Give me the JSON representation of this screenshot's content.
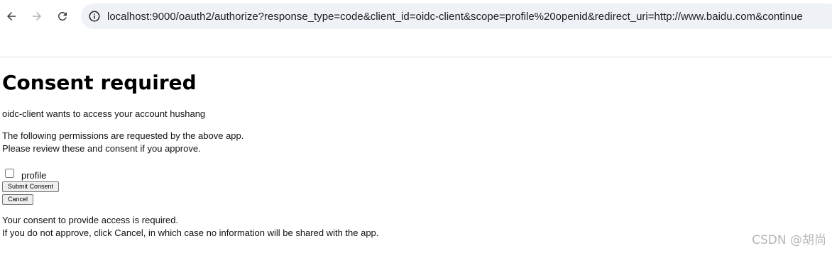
{
  "browser": {
    "url": "localhost:9000/oauth2/authorize?response_type=code&client_id=oidc-client&scope=profile%20openid&redirect_uri=http://www.baidu.com&continue"
  },
  "page": {
    "title": "Consent required",
    "client_line": "oidc-client wants to access your account hushang",
    "permissions_intro_1": "The following permissions are requested by the above app.",
    "permissions_intro_2": "Please review these and consent if you approve.",
    "scope": {
      "label": "profile",
      "checked": false
    },
    "submit_label": "Submit Consent",
    "cancel_label": "Cancel",
    "notice_1": "Your consent to provide access is required.",
    "notice_2": "If you do not approve, click Cancel, in which case no information will be shared with the app."
  },
  "watermark": "CSDN @胡尚",
  "icons": {
    "back": "arrow-left-icon",
    "forward": "arrow-right-icon",
    "reload": "reload-icon",
    "site_info": "info-icon"
  },
  "colors": {
    "omnibox_bg": "#eef1f6",
    "forward_disabled": "#b0b0b0",
    "button_bg": "#efefef"
  }
}
